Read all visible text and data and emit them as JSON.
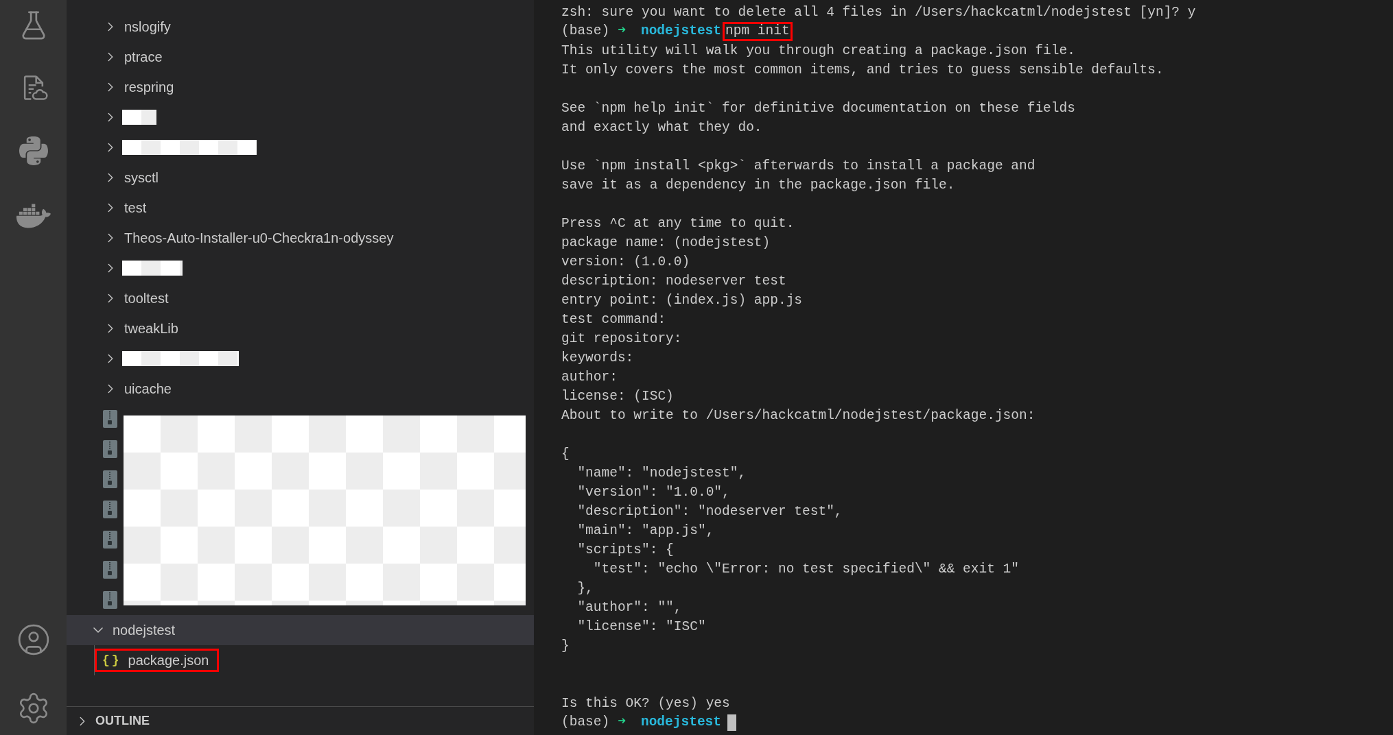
{
  "activity_bar": {
    "top_icons": [
      {
        "kind": "flask"
      },
      {
        "kind": "file-cloud"
      },
      {
        "kind": "python"
      },
      {
        "kind": "docker"
      }
    ],
    "bottom_icons": [
      {
        "kind": "account"
      },
      {
        "kind": "settings"
      }
    ]
  },
  "explorer": {
    "nested_items": [
      {
        "kind": "folder",
        "name": "nslogify"
      },
      {
        "kind": "folder",
        "name": "ptrace"
      },
      {
        "kind": "folder",
        "name": "respring"
      },
      {
        "kind": "redacted-folder"
      },
      {
        "kind": "redacted-folder"
      },
      {
        "kind": "folder",
        "name": "sysctl"
      },
      {
        "kind": "folder",
        "name": "test"
      },
      {
        "kind": "folder",
        "name": "Theos-Auto-Installer-u0-Checkra1n-odyssey"
      },
      {
        "kind": "redacted-folder"
      },
      {
        "kind": "folder",
        "name": "tooltest"
      },
      {
        "kind": "folder",
        "name": "tweakLib"
      },
      {
        "kind": "redacted-folder"
      },
      {
        "kind": "folder",
        "name": "uicache"
      }
    ],
    "archives": {
      "count_icons": [
        {
          "kind": "zip"
        },
        {
          "kind": "zip"
        },
        {
          "kind": "zip"
        },
        {
          "kind": "zip"
        },
        {
          "kind": "zip"
        },
        {
          "kind": "zip"
        },
        {
          "kind": "zip"
        }
      ],
      "redacted": true
    },
    "root_items": [
      {
        "name": "nodejstest",
        "expanded": true,
        "selected": true,
        "children": [
          {
            "kind": "json",
            "icon_text": "{}",
            "name": "package.json",
            "highlighted": true
          }
        ]
      }
    ],
    "outline": {
      "title": "OUTLINE",
      "expanded": false
    }
  },
  "terminal": {
    "lines": [
      {
        "kind": "text",
        "text": "zsh: sure you want to delete all 4 files in /Users/hackcatml/nodejstest [yn]? y"
      },
      {
        "kind": "prompt",
        "env": "(base)",
        "arrow": "➜",
        "dir": "nodejstest",
        "command": "npm init",
        "highlighted": true
      },
      {
        "kind": "text",
        "text": "This utility will walk you through creating a package.json file."
      },
      {
        "kind": "text",
        "text": "It only covers the most common items, and tries to guess sensible defaults."
      },
      {
        "kind": "blank"
      },
      {
        "kind": "text",
        "text": "See `npm help init` for definitive documentation on these fields"
      },
      {
        "kind": "text",
        "text": "and exactly what they do."
      },
      {
        "kind": "blank"
      },
      {
        "kind": "text",
        "text": "Use `npm install <pkg>` afterwards to install a package and"
      },
      {
        "kind": "text",
        "text": "save it as a dependency in the package.json file."
      },
      {
        "kind": "blank"
      },
      {
        "kind": "text",
        "text": "Press ^C at any time to quit."
      },
      {
        "kind": "text",
        "text": "package name: (nodejstest)"
      },
      {
        "kind": "text",
        "text": "version: (1.0.0)"
      },
      {
        "kind": "text",
        "text": "description: nodeserver test"
      },
      {
        "kind": "text",
        "text": "entry point: (index.js) app.js"
      },
      {
        "kind": "text",
        "text": "test command:"
      },
      {
        "kind": "text",
        "text": "git repository:"
      },
      {
        "kind": "text",
        "text": "keywords:"
      },
      {
        "kind": "text",
        "text": "author:"
      },
      {
        "kind": "text",
        "text": "license: (ISC)"
      },
      {
        "kind": "text",
        "text": "About to write to /Users/hackcatml/nodejstest/package.json:"
      },
      {
        "kind": "blank"
      },
      {
        "kind": "text",
        "text": "{"
      },
      {
        "kind": "text",
        "text": "  \"name\": \"nodejstest\","
      },
      {
        "kind": "text",
        "text": "  \"version\": \"1.0.0\","
      },
      {
        "kind": "text",
        "text": "  \"description\": \"nodeserver test\","
      },
      {
        "kind": "text",
        "text": "  \"main\": \"app.js\","
      },
      {
        "kind": "text",
        "text": "  \"scripts\": {"
      },
      {
        "kind": "text",
        "text": "    \"test\": \"echo \\\"Error: no test specified\\\" && exit 1\""
      },
      {
        "kind": "text",
        "text": "  },"
      },
      {
        "kind": "text",
        "text": "  \"author\": \"\","
      },
      {
        "kind": "text",
        "text": "  \"license\": \"ISC\""
      },
      {
        "kind": "text",
        "text": "}"
      },
      {
        "kind": "blank"
      },
      {
        "kind": "blank"
      },
      {
        "kind": "text",
        "text": "Is this OK? (yes) yes"
      },
      {
        "kind": "prompt",
        "env": "(base)",
        "arrow": "➜",
        "dir": "nodejstest",
        "cursor": true
      }
    ]
  }
}
